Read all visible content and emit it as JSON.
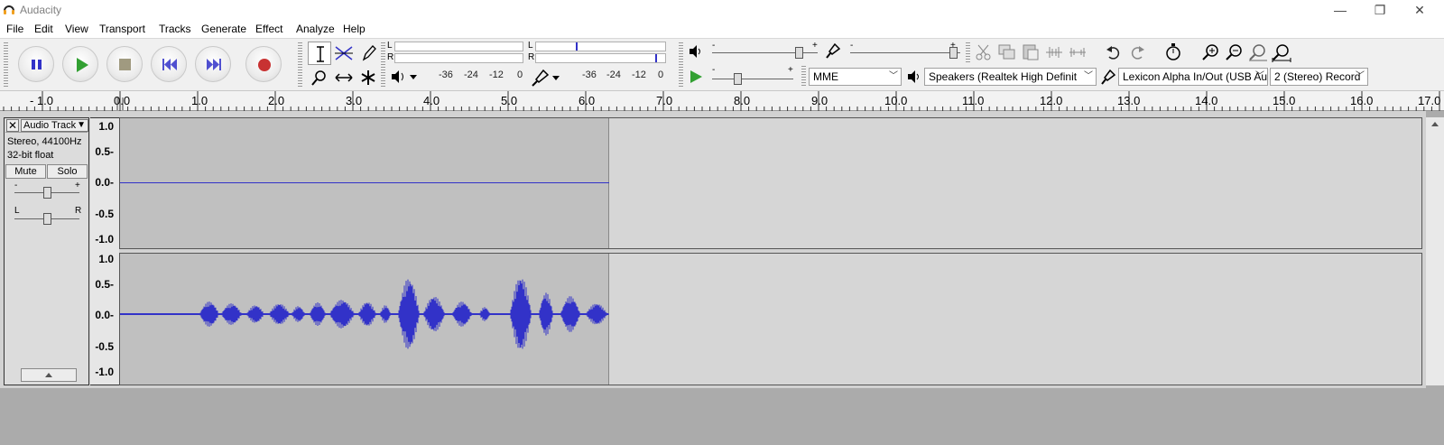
{
  "window": {
    "title": "Audacity",
    "minimize": "—",
    "restore": "❐",
    "close": "✕"
  },
  "menu": [
    "File",
    "Edit",
    "View",
    "Transport",
    "Tracks",
    "Generate",
    "Effect",
    "Analyze",
    "Help"
  ],
  "meters": {
    "play_l": "L",
    "play_r": "R",
    "rec_l": "L",
    "rec_r": "R",
    "scale_play": [
      "-36",
      "-24",
      "-12",
      "0"
    ],
    "scale_rec": [
      "-36",
      "-24",
      "-12",
      "0"
    ]
  },
  "device": {
    "host": "MME",
    "output": "Speakers (Realtek High Definit",
    "input": "Lexicon Alpha In/Out (USB Au",
    "channels": "2 (Stereo) Record"
  },
  "slider_marks": {
    "minus": "-",
    "plus": "+"
  },
  "ruler": [
    "- 1.0",
    "0.0",
    "1.0",
    "2.0",
    "3.0",
    "4.0",
    "5.0",
    "6.0",
    "7.0",
    "8.0",
    "9.0",
    "10.0",
    "11.0",
    "12.0",
    "13.0",
    "14.0",
    "15.0",
    "16.0",
    "17.0"
  ],
  "track": {
    "name": "Audio Track",
    "format": "Stereo, 44100Hz",
    "bits": "32-bit float",
    "mute": "Mute",
    "solo": "Solo",
    "pan_l": "L",
    "pan_r": "R",
    "gain_minus": "-",
    "gain_plus": "+",
    "scale": [
      "1.0",
      "0.5-",
      "0.0-",
      "-0.5",
      "-1.0"
    ]
  },
  "colors": {
    "waveform": "#3232c8",
    "selection_bg": "#c0c0c0",
    "track_bg": "#d6d6d6",
    "record": "#c83232",
    "play": "#32a032",
    "transport_blue": "#3232c8"
  }
}
